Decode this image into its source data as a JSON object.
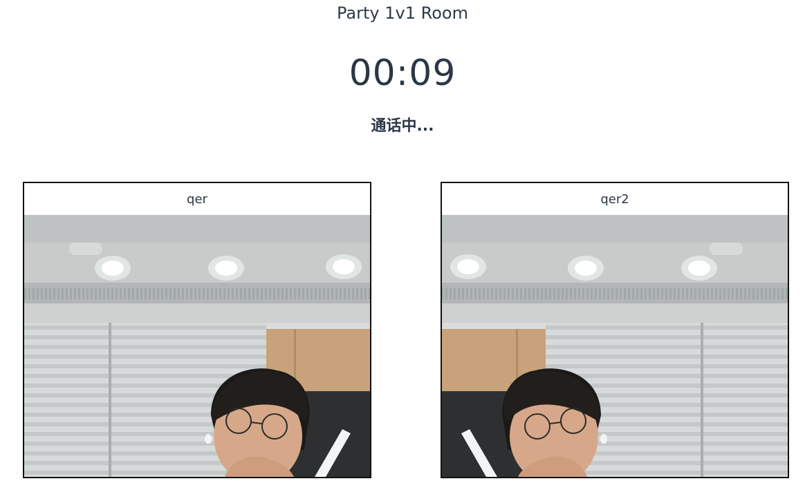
{
  "room": {
    "title": "Party 1v1 Room"
  },
  "call": {
    "timer": "00:09",
    "status": "通话中..."
  },
  "participants": [
    {
      "name": "qer"
    },
    {
      "name": "qer2"
    }
  ]
}
